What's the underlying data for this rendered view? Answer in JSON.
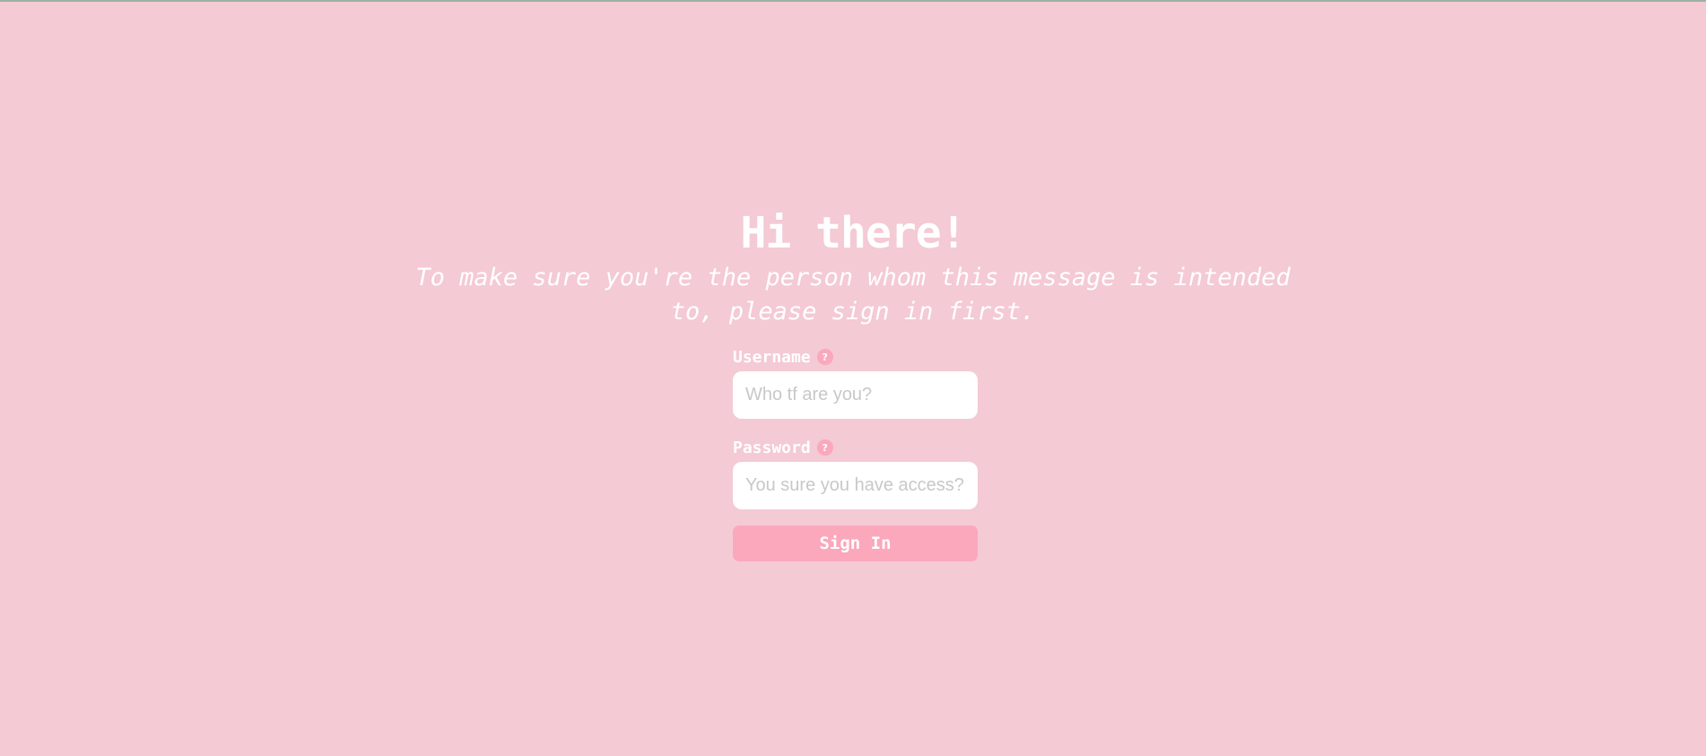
{
  "heading": {
    "title": "Hi there!",
    "subtitle": "To make sure you're the person whom this message is intended to, please sign in first."
  },
  "form": {
    "username": {
      "label": "Username",
      "help_glyph": "?",
      "value": "",
      "placeholder": "Who tf are you?"
    },
    "password": {
      "label": "Password",
      "help_glyph": "?",
      "value": "",
      "placeholder": "You sure you have access?"
    },
    "submit_label": "Sign In"
  },
  "colors": {
    "background": "#f4cad4",
    "accent": "#fba8bc",
    "text": "#ffffff",
    "field_background": "#ffffff",
    "placeholder": "#c8c8c8"
  },
  "icons": {
    "username_help": "question-mark-icon",
    "password_help": "question-mark-icon"
  }
}
